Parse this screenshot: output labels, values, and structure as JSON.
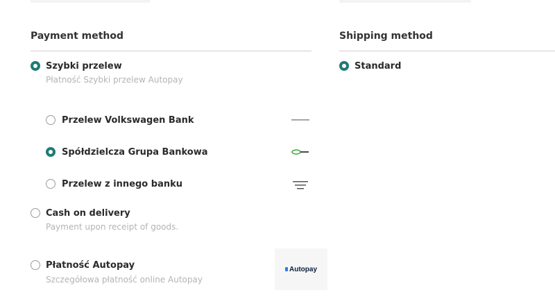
{
  "payment": {
    "title": "Payment method",
    "options": [
      {
        "label": "Szybki przelew",
        "desc": "Płatność Szybki przelew Autopay",
        "checked": true
      },
      {
        "label": "Cash on delivery",
        "desc": "Payment upon receipt of goods.",
        "checked": false
      },
      {
        "label": "Płatność  Autopay",
        "desc": "Szczegółowa płatność online Autopay",
        "checked": false
      }
    ],
    "banks": [
      {
        "label": "Przelew Volkswagen Bank",
        "checked": false
      },
      {
        "label": "Spółdzielcza Grupa Bankowa",
        "checked": true
      },
      {
        "label": "Przelew z innego banku",
        "checked": false
      }
    ],
    "autopay_logo_text": "Autopay"
  },
  "shipping": {
    "title": "Shipping method",
    "options": [
      {
        "label": "Standard",
        "checked": true
      }
    ]
  },
  "colors": {
    "accent": "#1f7b76",
    "divider": "#cfcfcf",
    "muted_text": "#b4b4b4"
  }
}
